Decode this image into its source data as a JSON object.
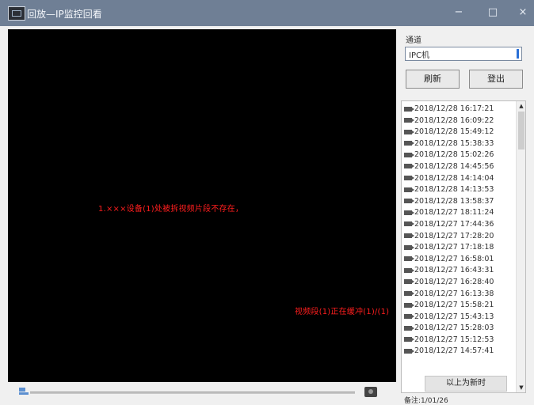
{
  "window": {
    "title": "回放—IP监控回看",
    "min_glyph": "−",
    "max_glyph": "□",
    "close_glyph": "×"
  },
  "video": {
    "message_1": "1.×××设备(1)处被拆视频片段不存在，",
    "message_2": "视频段(1)正在缓冲(1)/(1)"
  },
  "panel": {
    "channel_label": "通道",
    "channel_value": "IPC机",
    "refresh_label": "刷新",
    "logout_label": "登出",
    "load_more_label": "以上为新时",
    "status_text": "备注:1/01/26"
  },
  "records": [
    "2018/12/28 16:17:21",
    "2018/12/28 16:09:22",
    "2018/12/28 15:49:12",
    "2018/12/28 15:38:33",
    "2018/12/28 15:02:26",
    "2018/12/28 14:45:56",
    "2018/12/28 14:14:04",
    "2018/12/28 14:13:53",
    "2018/12/28 13:58:37",
    "2018/12/27 18:11:24",
    "2018/12/27 17:44:36",
    "2018/12/27 17:28:20",
    "2018/12/27 17:18:18",
    "2018/12/27 16:58:01",
    "2018/12/27 16:43:31",
    "2018/12/27 16:28:40",
    "2018/12/27 16:13:38",
    "2018/12/27 15:58:21",
    "2018/12/27 15:43:13",
    "2018/12/27 15:28:03",
    "2018/12/27 15:12:53",
    "2018/12/27 14:57:41"
  ],
  "icons": {
    "app": "app-icon",
    "record": "video-record-icon",
    "snapshot": "camera-icon",
    "playhead": "playhead-icon"
  },
  "colors": {
    "titlebar": "#6f7f95",
    "video_bg": "#000000",
    "message": "#ff1e1e",
    "accent": "#2a6fd6"
  }
}
